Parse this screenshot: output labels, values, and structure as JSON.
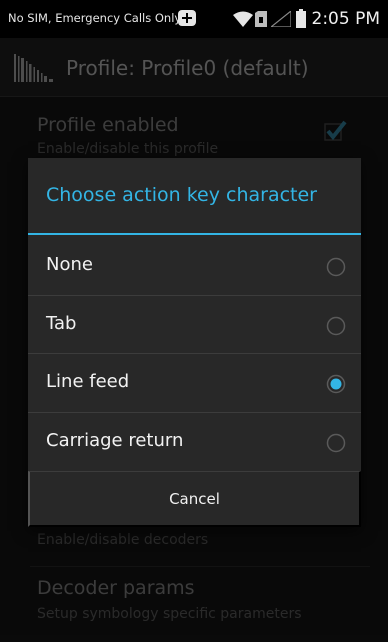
{
  "status_bar": {
    "carrier_text": "No SIM, Emergency Calls Only",
    "time": "2:05 PM",
    "icons": [
      "plus-icon",
      "wifi-icon",
      "sim-icon",
      "signal-icon",
      "battery-icon"
    ]
  },
  "action_bar": {
    "title": "Profile: Profile0 (default)",
    "icon": "scanner-app-icon"
  },
  "background_list": {
    "items": [
      {
        "title": "Profile enabled",
        "summary": "Enable/disable this profile",
        "checked": true
      },
      {
        "title": "",
        "summary": "Enable/disable decoders"
      },
      {
        "title": "Decoder params",
        "summary": "Setup symbology specific parameters"
      }
    ]
  },
  "dialog": {
    "title": "Choose action key character",
    "options": [
      {
        "label": "None",
        "selected": false
      },
      {
        "label": "Tab",
        "selected": false
      },
      {
        "label": "Line feed",
        "selected": true
      },
      {
        "label": "Carriage return",
        "selected": false
      }
    ],
    "cancel_label": "Cancel"
  },
  "colors": {
    "accent": "#33b5e5",
    "dialog_background": "#282828",
    "screen_background": "#121212"
  }
}
